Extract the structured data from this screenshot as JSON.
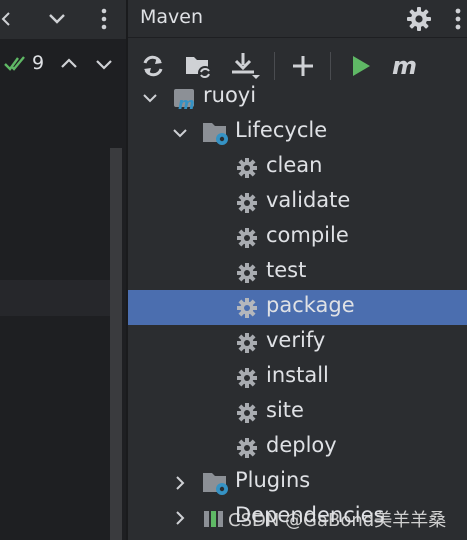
{
  "left_panel": {
    "inspection_count": "9"
  },
  "maven": {
    "title": "Maven",
    "toolbar": {
      "reload": "reload-icon",
      "generate_sources": "folder-reload-icon",
      "download": "download-icon",
      "add": "plus-icon",
      "run": "run-icon",
      "execute_goal": "maven-m-icon"
    },
    "tree": {
      "project": "ruoyi",
      "lifecycle_label": "Lifecycle",
      "goals": [
        "clean",
        "validate",
        "compile",
        "test",
        "package",
        "verify",
        "install",
        "site",
        "deploy"
      ],
      "selected_goal": "package",
      "plugins_label": "Plugins",
      "dependencies_label": "Dependencies"
    }
  },
  "watermark": "CSDN @GaBond美羊羊桑",
  "colors": {
    "background": "#2b2d30",
    "editor_background": "#1e1f22",
    "selection": "#4b6eaf",
    "run_green": "#5fb865",
    "folder_gray": "#8c9096",
    "accent_blue": "#3592c4"
  }
}
